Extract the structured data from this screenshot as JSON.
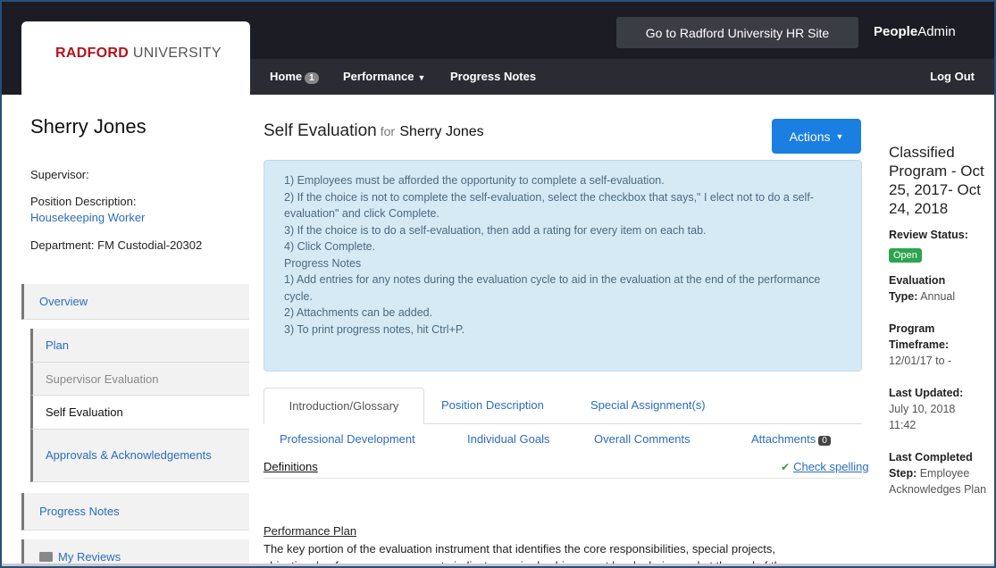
{
  "header": {
    "logo_bold": "RADFORD",
    "logo_rest": " UNIVERSITY",
    "hr_site_button": "Go to Radford University HR Site",
    "brand_bold": "People",
    "brand_rest": "Admin"
  },
  "nav": {
    "home": "Home",
    "home_badge": "1",
    "performance": "Performance",
    "progress_notes": "Progress Notes",
    "logout": "Log Out"
  },
  "sidebar": {
    "person_name": "Sherry Jones",
    "supervisor_label": "Supervisor:",
    "position_label": "Position Description:",
    "position_value": "Housekeeping Worker",
    "department_label": "Department:",
    "department_value": " FM Custodial-20302",
    "items": [
      {
        "label": "Overview"
      },
      {
        "label": "Plan"
      },
      {
        "label": "Supervisor Evaluation"
      },
      {
        "label": "Self Evaluation"
      },
      {
        "label": "Approvals & Acknowledgements"
      },
      {
        "label": "Progress Notes"
      },
      {
        "label": "My Reviews"
      }
    ]
  },
  "main": {
    "title": "Self Evaluation",
    "title_for": "for",
    "title_name": "Sherry Jones",
    "actions_button": "Actions",
    "info_lines": [
      "1) Employees must be afforded the opportunity to complete a self-evaluation.",
      "2) If the choice is not to complete the self-evaluation, select the checkbox that says,\" I elect not to do a self-evaluation\" and click Complete.",
      "3) If the choice is to do a self-evaluation, then add a rating for every item on each tab.",
      "4) Click Complete.",
      "Progress Notes",
      "1) Add entries for any notes during the evaluation cycle to aid in the evaluation at the end of the performance cycle.",
      "2) Attachments can be added.",
      "3) To print progress notes, hit Ctrl+P."
    ],
    "tabs": [
      {
        "label": "Introduction/Glossary"
      },
      {
        "label": "Position Description"
      },
      {
        "label": "Special Assignment(s)"
      },
      {
        "label": "Professional Development"
      },
      {
        "label": "Individual Goals"
      },
      {
        "label": "Overall Comments"
      },
      {
        "label": "Attachments"
      }
    ],
    "attachments_count": "0",
    "definitions": "Definitions",
    "check_spelling": "Check spelling",
    "pp_title": "Performance Plan",
    "pp_text": "The key portion of the evaluation instrument that identifies the core responsibilities, special projects, objectives/performance measures to indicate required achievement levels during and at the end of the performance cycle."
  },
  "right_panel": {
    "program_title": "Classified Program - Oct 25, 2017- Oct 24, 2018",
    "review_status_label": "Review Status:",
    "review_status_value": "Open",
    "evaluation_label": "Evaluation",
    "type_label": "Type:",
    "type_value": " Annual",
    "program_label": "Program",
    "timeframe_label": "Timeframe:",
    "timeframe_value": "12/01/17 to -",
    "last_updated_label": "Last Updated:",
    "last_updated_value": "July 10, 2018 11:42",
    "last_completed_label": "Last Completed",
    "step_label": "Step:",
    "step_value": " Employee Acknowledges Plan"
  },
  "colors": {
    "accent": "#1a7fe0",
    "link": "#2a6ebb",
    "status_open": "#2ea44f",
    "topbar": "#1c1c24"
  }
}
